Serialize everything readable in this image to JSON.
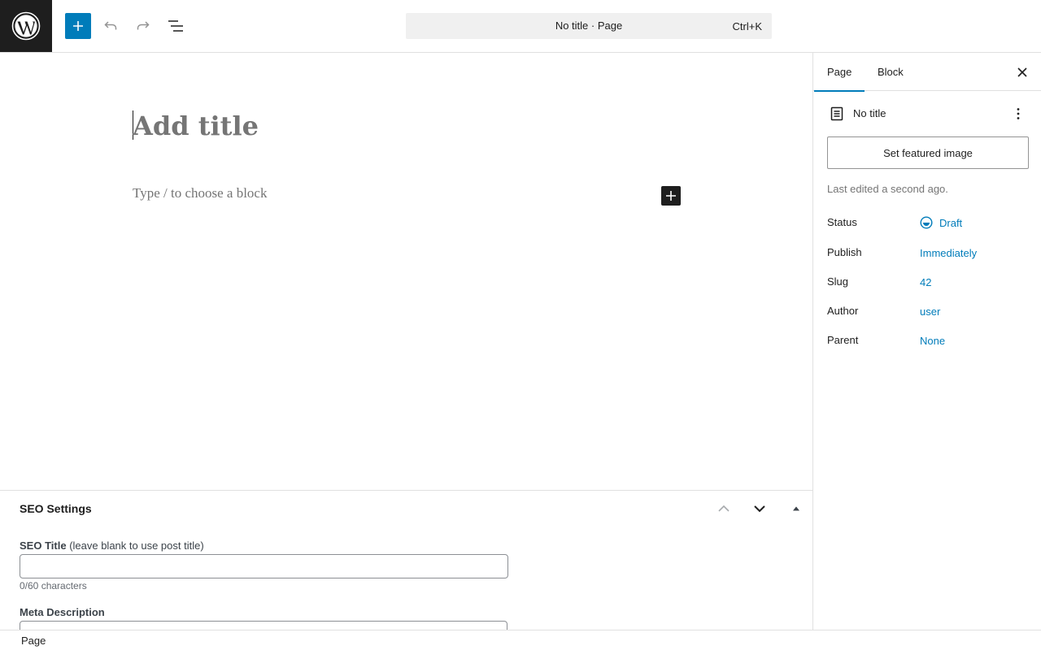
{
  "header": {
    "command_title": "No title · Page",
    "command_shortcut": "Ctrl+K",
    "icons": [
      "wordpress-logo-icon",
      "plus-icon",
      "undo-icon",
      "redo-icon",
      "list-view-icon"
    ],
    "accent_color": "#007cba"
  },
  "editor": {
    "title_placeholder": "Add title",
    "block_placeholder": "Type / to choose a block"
  },
  "seo_settings": {
    "heading": "SEO Settings",
    "seo_title_label": "SEO Title",
    "seo_title_hint": "(leave blank to use post title)",
    "seo_title_value": "",
    "char_count": "0/60 characters",
    "meta_description_label": "Meta Description"
  },
  "sidebar": {
    "tabs": [
      "Page",
      "Block"
    ],
    "active_tab": "Page",
    "doc_title": "No title",
    "featured_image_button": "Set featured image",
    "last_edited": "Last edited a second ago.",
    "rows": [
      {
        "label": "Status",
        "value": "Draft"
      },
      {
        "label": "Publish",
        "value": "Immediately"
      },
      {
        "label": "Slug",
        "value": "42"
      },
      {
        "label": "Author",
        "value": "user"
      },
      {
        "label": "Parent",
        "value": "None"
      }
    ]
  },
  "statusbar": {
    "breadcrumb": "Page"
  }
}
